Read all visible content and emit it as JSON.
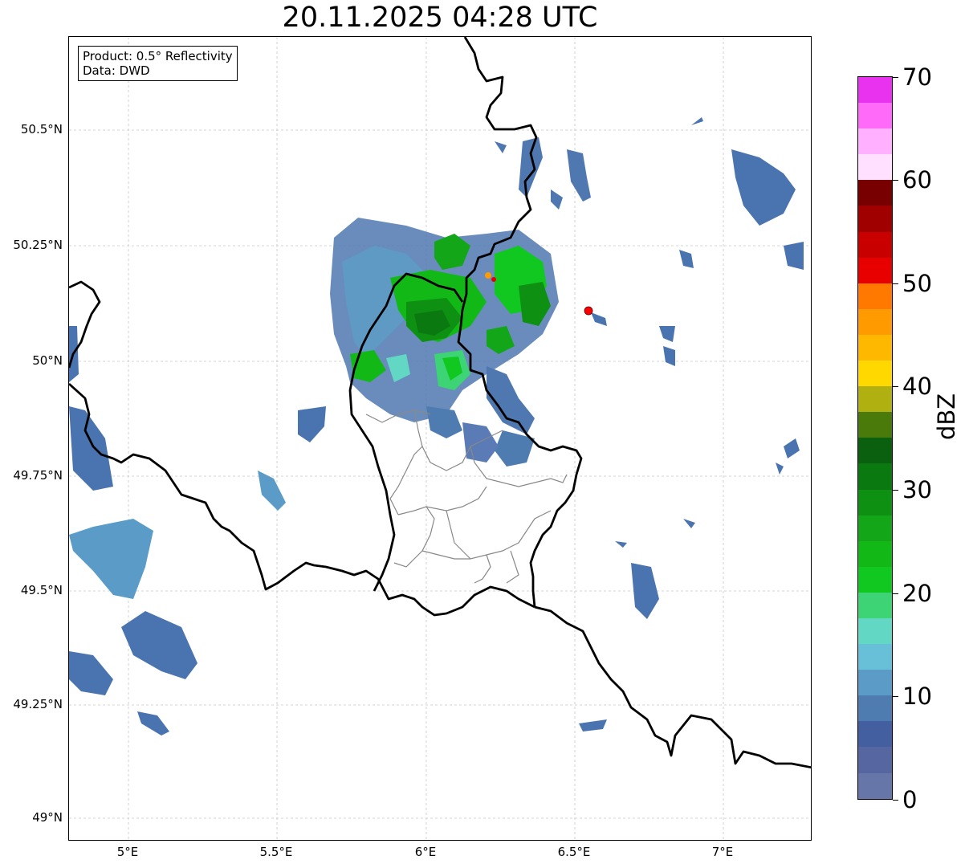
{
  "title": "20.11.2025 04:28 UTC",
  "info": {
    "line1": "Product: 0.5° Reflectivity",
    "line2": "Data: DWD"
  },
  "axes": {
    "y_ticks": [
      "50.5°N",
      "50.25°N",
      "50°N",
      "49.75°N",
      "49.5°N",
      "49.25°N",
      "49°N"
    ],
    "x_ticks": [
      "5°E",
      "5.5°E",
      "6°E",
      "6.5°E",
      "7°E"
    ]
  },
  "colorbar": {
    "label": "dBZ",
    "ticks": [
      "0",
      "10",
      "20",
      "30",
      "40",
      "50",
      "60",
      "70"
    ],
    "colors": [
      "#6676a8",
      "#5566a0",
      "#445fa0",
      "#4e7bb0",
      "#5a9bc8",
      "#68c0d8",
      "#62d8c4",
      "#3cd474",
      "#10c820",
      "#12b816",
      "#12a618",
      "#0e9012",
      "#0a7a10",
      "#0a600e",
      "#4a7a0a",
      "#b0b010",
      "#ffd800",
      "#ffb800",
      "#ff9a00",
      "#ff7800",
      "#e80000",
      "#c80000",
      "#a00000",
      "#780000",
      "#ffe0ff",
      "#ffb0ff",
      "#ff6af8",
      "#e832f0"
    ]
  },
  "map": {
    "radar_site_color": "#ff0000",
    "grid_color": "#c8c8c8",
    "border_color": "#000000",
    "admin_color": "#888888"
  }
}
